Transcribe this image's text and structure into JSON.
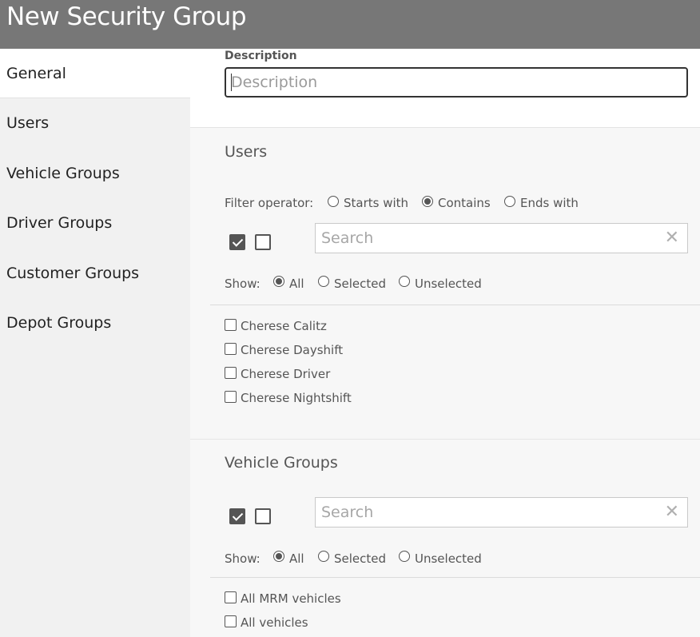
{
  "window": {
    "title": "New Security Group"
  },
  "sidebar": {
    "items": [
      {
        "label": "General"
      },
      {
        "label": "Users"
      },
      {
        "label": "Vehicle Groups"
      },
      {
        "label": "Driver Groups"
      },
      {
        "label": "Customer Groups"
      },
      {
        "label": "Depot Groups"
      }
    ],
    "active": "General"
  },
  "general": {
    "description_label": "Description",
    "description_placeholder": "Description",
    "description_value": ""
  },
  "users": {
    "title": "Users",
    "filter_label": "Filter operator:",
    "filter_options": [
      "Starts with",
      "Contains",
      "Ends with"
    ],
    "filter_selected": "Contains",
    "search_placeholder": "Search",
    "show_label": "Show:",
    "show_options": [
      "All",
      "Selected",
      "Unselected"
    ],
    "show_selected": "All",
    "items": [
      "Cherese Calitz",
      "Cherese Dayshift",
      "Cherese Driver",
      "Cherese Nightshift"
    ]
  },
  "vehicle_groups": {
    "title": "Vehicle Groups",
    "search_placeholder": "Search",
    "show_label": "Show:",
    "show_options": [
      "All",
      "Selected",
      "Unselected"
    ],
    "show_selected": "All",
    "items": [
      "All MRM vehicles",
      "All vehicles"
    ]
  },
  "icons": {
    "clear": "close-icon",
    "select_all": "check-all-icon",
    "deselect_all": "uncheck-all-icon"
  },
  "colors": {
    "titlebar": "#777777",
    "sidebar": "#f1f1f1",
    "accent": "#555555"
  }
}
